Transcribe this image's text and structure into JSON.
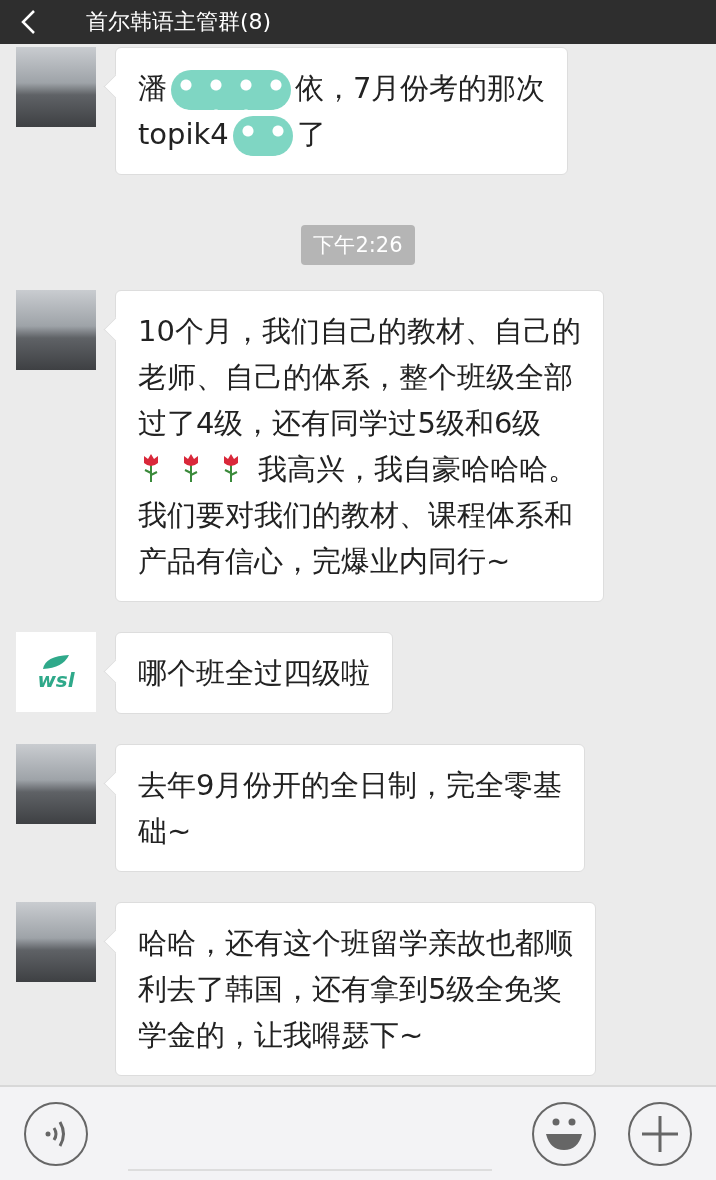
{
  "header": {
    "title": "首尔韩语主管群(8)"
  },
  "messages": [
    {
      "kind": "message",
      "avatar": {
        "kind": "photo"
      },
      "parts": [
        {
          "kind": "text",
          "text": "潘"
        },
        {
          "kind": "redacted"
        },
        {
          "kind": "text",
          "text": "依，7月份考的那次"
        },
        {
          "kind": "break"
        },
        {
          "kind": "text",
          "text": "topik4"
        },
        {
          "kind": "redacted"
        },
        {
          "kind": "text",
          "text": "了"
        }
      ]
    },
    {
      "kind": "time",
      "text": "下午2:26"
    },
    {
      "kind": "message",
      "avatar": {
        "kind": "photo"
      },
      "parts": [
        {
          "kind": "text",
          "text": "10个月，我们自己的教材、自己的"
        },
        {
          "kind": "break"
        },
        {
          "kind": "text",
          "text": "老师、自己的体系，整个班级全部"
        },
        {
          "kind": "break"
        },
        {
          "kind": "text",
          "text": "过了4级，还有同学过5级和6级"
        },
        {
          "kind": "break"
        },
        {
          "kind": "rose"
        },
        {
          "kind": "rose"
        },
        {
          "kind": "rose"
        },
        {
          "kind": "text",
          "text": "我高兴，我自豪哈哈哈。"
        },
        {
          "kind": "break"
        },
        {
          "kind": "text",
          "text": "我们要对我们的教材、课程体系和"
        },
        {
          "kind": "break"
        },
        {
          "kind": "text",
          "text": "产品有信心，完爆业内同行~"
        }
      ]
    },
    {
      "kind": "message",
      "avatar": {
        "kind": "logo",
        "text": "wsl"
      },
      "parts": [
        {
          "kind": "text",
          "text": "哪个班全过四级啦"
        }
      ]
    },
    {
      "kind": "message",
      "avatar": {
        "kind": "photo"
      },
      "parts": [
        {
          "kind": "text",
          "text": "去年9月份开的全日制，完全零基"
        },
        {
          "kind": "break"
        },
        {
          "kind": "text",
          "text": "础~"
        }
      ]
    },
    {
      "kind": "message",
      "avatar": {
        "kind": "photo"
      },
      "parts": [
        {
          "kind": "text",
          "text": "哈哈，还有这个班留学亲故也都顺"
        },
        {
          "kind": "break"
        },
        {
          "kind": "text",
          "text": "利去了韩国，还有拿到5级全免奖"
        },
        {
          "kind": "break"
        },
        {
          "kind": "text",
          "text": "学金的，让我嘚瑟下~"
        }
      ]
    }
  ]
}
